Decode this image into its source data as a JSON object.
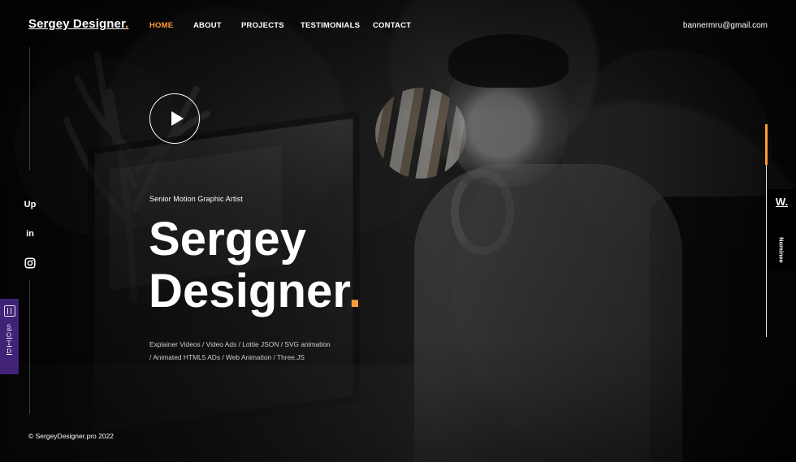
{
  "brand": {
    "name": "Sergey Designer",
    "dot": "."
  },
  "navigation": {
    "items": [
      {
        "label": "HOME",
        "active": true
      },
      {
        "label": "ABOUT",
        "active": false
      },
      {
        "label": "PROJECTS",
        "active": false
      },
      {
        "label": "TESTIMONIALS",
        "active": false
      },
      {
        "label": "CONTACT",
        "active": false
      }
    ],
    "email": "bannermru@gmail.com"
  },
  "hero": {
    "eyebrow": "Senior Motion Graphic Artist",
    "title_line_1": "Sergey",
    "title_line_2": "Designer",
    "title_dot": ".",
    "services": "Explainer Videos / Video Ads / Lottie JSON / SVG animation / Animated HTML5 ADs / Web Animation / Three.JS"
  },
  "socials": [
    {
      "label": "Up",
      "icon": "upwork-icon"
    },
    {
      "label": "in",
      "icon": "linkedin-icon"
    },
    {
      "label": "",
      "icon": "instagram-icon"
    }
  ],
  "badges": {
    "sotd": "SOTD",
    "nominee_logo": "W.",
    "nominee_label": "Nominee"
  },
  "footer": {
    "copyright": "© SergeyDesigner.pro 2022"
  },
  "colors": {
    "accent": "#ff9b35",
    "background": "#151515",
    "text": "#ffffff",
    "sotd": "#402277"
  },
  "icons": {
    "play": "play-icon",
    "sotd": "sotd-icon",
    "nominee": "awwwards-w-icon"
  }
}
